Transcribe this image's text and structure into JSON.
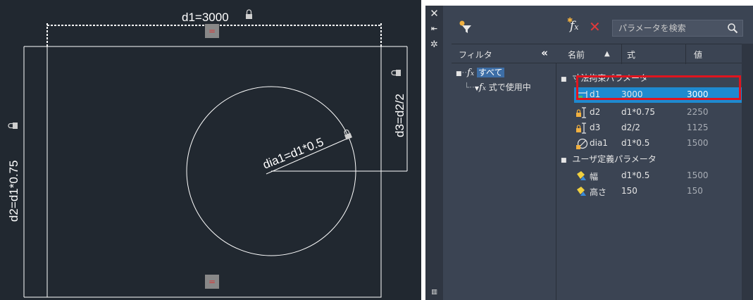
{
  "drawing": {
    "dimensions": {
      "d1": "d1=3000",
      "d2": "d2=d1*0.75",
      "d3": "d3=d2/2",
      "dia1": "dia1=d1*0.5"
    },
    "equal_marker": "="
  },
  "palette": {
    "strip_icons": [
      "close-icon",
      "autohide-icon",
      "settings-icon"
    ],
    "toolbar": {
      "filter_icon": "filter-icon",
      "new_param_icon": "fx-new-icon",
      "delete_icon": "delete-x-icon",
      "search_placeholder": "パラメータを検索"
    },
    "filter": {
      "title": "フィルタ",
      "collapse_label": "«",
      "tree": {
        "all": "すべて",
        "used_in_expr": "式で使用中"
      }
    },
    "grid": {
      "columns": {
        "name": "名前",
        "expr": "式",
        "value": "値"
      },
      "sort_indicator": "▲",
      "categories": [
        {
          "label": "寸法拘束パラメータ",
          "toggle": "■"
        },
        {
          "label": "ユーザ定義パラメータ",
          "toggle": "■"
        }
      ],
      "dimensional_rows": [
        {
          "name": "d1",
          "expr": "3000",
          "value": "3000",
          "icon": "linear-dim-icon",
          "selected": true
        },
        {
          "name": "d2",
          "expr": "d1*0.75",
          "value": "2250",
          "icon": "vertical-dim-icon",
          "selected": false
        },
        {
          "name": "d3",
          "expr": "d2/2",
          "value": "1125",
          "icon": "vertical-dim-icon",
          "selected": false
        },
        {
          "name": "dia1",
          "expr": "d1*0.5",
          "value": "1500",
          "icon": "diameter-dim-icon",
          "selected": false
        }
      ],
      "user_rows": [
        {
          "name": "幅",
          "expr": "d1*0.5",
          "value": "1500",
          "icon": "user-param-icon"
        },
        {
          "name": "高さ",
          "expr": "150",
          "value": "150",
          "icon": "user-param-icon"
        }
      ]
    },
    "accent_selected": "#1e8ad0",
    "highlight_color": "#e0141e"
  }
}
